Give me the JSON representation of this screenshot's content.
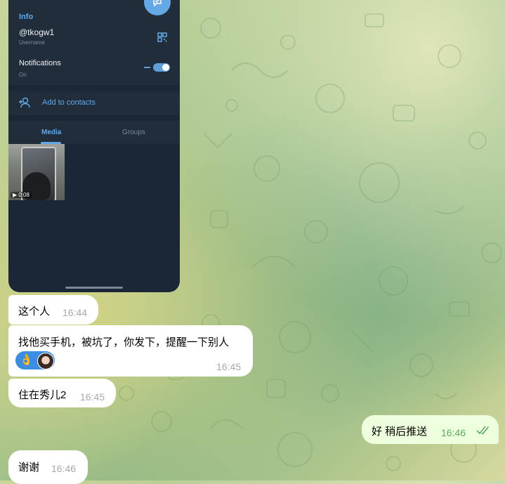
{
  "profile": {
    "info_title": "Info",
    "username": "@tkogw1",
    "username_label": "Username",
    "notifications_label": "Notifications",
    "notifications_state": "On",
    "add_contact_label": "Add to contacts",
    "tabs": [
      {
        "label": "Media"
      },
      {
        "label": "Groups"
      }
    ],
    "media": [
      {
        "duration": "0:08"
      }
    ],
    "accent_color": "#63a8e6",
    "bg_color": "#1b2636"
  },
  "messages": [
    {
      "text": "这个人",
      "time": "16:44",
      "direction": "incoming"
    },
    {
      "text": "找他买手机，被坑了，你发下，提醒一下别人",
      "time": "16:45",
      "direction": "incoming",
      "reactions": [
        "ok-hand-icon",
        "avatar"
      ]
    },
    {
      "text": "住在秀儿2",
      "time": "16:45",
      "direction": "incoming"
    },
    {
      "text": "好 稍后推送",
      "time": "16:46",
      "direction": "outgoing",
      "status": "read"
    },
    {
      "text": "谢谢",
      "time": "16:46",
      "direction": "incoming"
    }
  ],
  "colors": {
    "incoming_bubble": "#ffffff",
    "outgoing_bubble": "#eeffde",
    "reaction": "#3d8de0",
    "read_ticks": "#5eaa62"
  }
}
